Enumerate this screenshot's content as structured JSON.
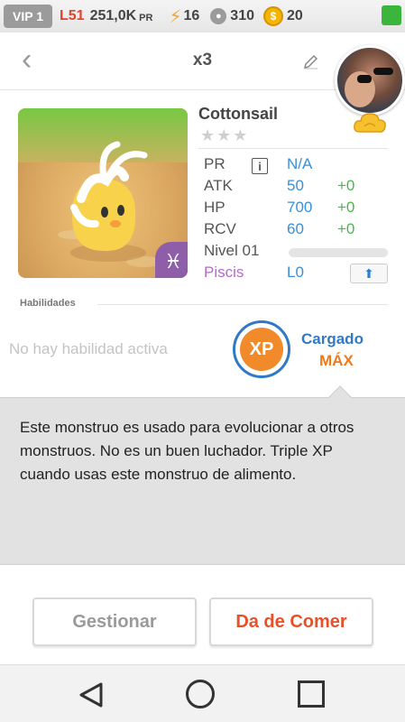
{
  "status": {
    "vip": "VIP 1",
    "level": "L51",
    "pr_value": "251,0K",
    "pr_unit": "PR",
    "energy": "16",
    "stamina": "310",
    "coins": "20"
  },
  "header": {
    "count": "x3"
  },
  "monster": {
    "name": "Cottonsail",
    "stars": "★★★",
    "zodiac_symbol": "♓",
    "stats": {
      "pr_label": "PR",
      "pr_value": "N/A",
      "atk_label": "ATK",
      "atk_value": "50",
      "atk_bonus": "+0",
      "hp_label": "HP",
      "hp_value": "700",
      "hp_bonus": "+0",
      "rcv_label": "RCV",
      "rcv_value": "60",
      "rcv_bonus": "+0",
      "level_label": "Nivel 01",
      "level_progress": 0,
      "zodiac_label": "Piscis",
      "zodiac_level": "L0"
    }
  },
  "skills": {
    "section_label": "Habilidades",
    "none_text": "No hay habilidad activa",
    "xp_badge": "XP",
    "charged_label": "Cargado",
    "max_label": "MÁX"
  },
  "description": "Este monstruo es usado para evolucionar a otros monstruos. No es un buen luchador. Triple XP  cuando usas este monstruo de alimento.",
  "actions": {
    "manage": "Gestionar",
    "feed": "Da de Comer"
  },
  "colors": {
    "accent_blue": "#2f79c7",
    "accent_orange": "#f07a1a",
    "feed_red": "#e8502a",
    "bonus_green": "#4cb84c"
  }
}
